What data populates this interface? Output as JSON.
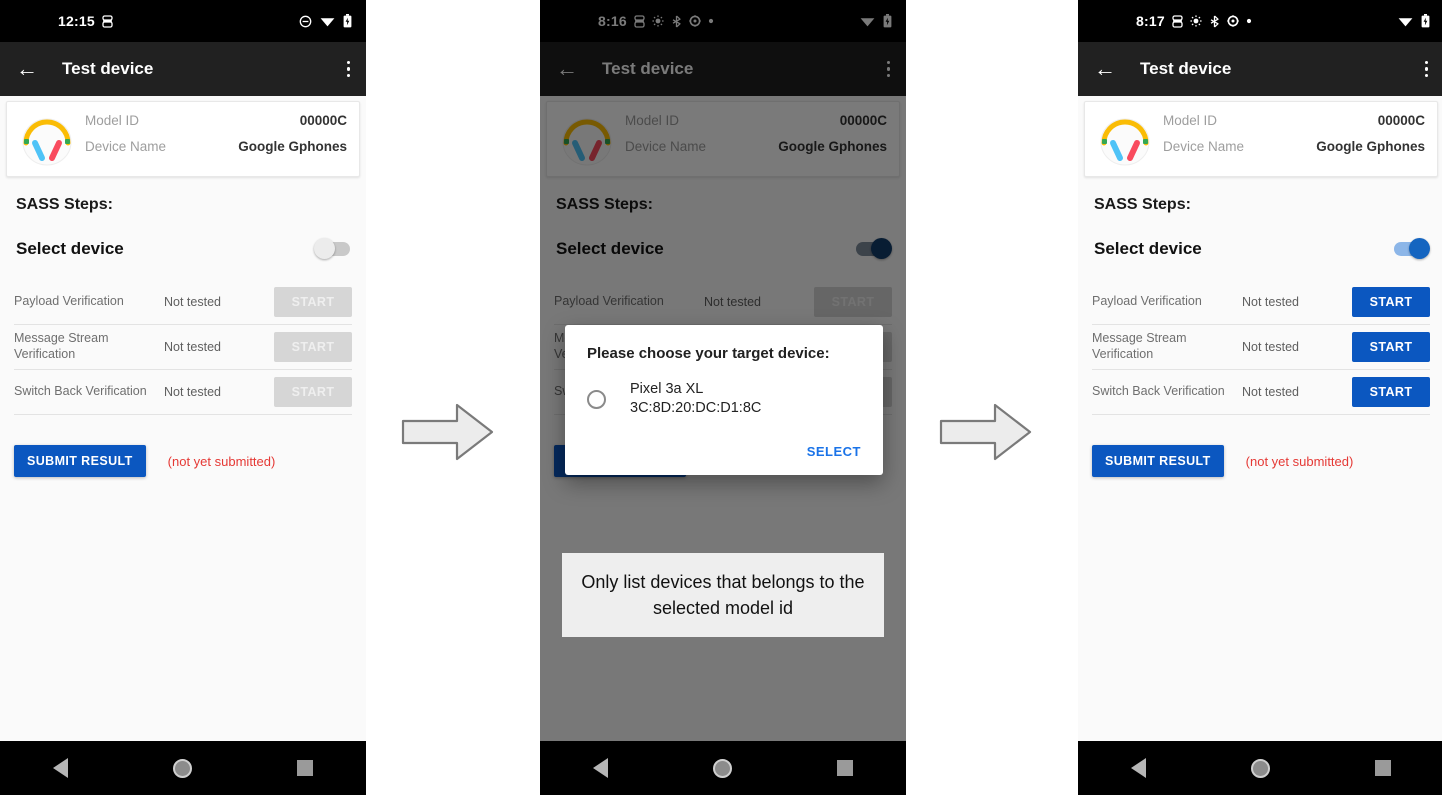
{
  "panels": [
    {
      "id": "panel-initial",
      "status_bar": {
        "time": "12:15",
        "left_icons": [
          "android-debug-icon"
        ],
        "right_icons": [
          "dnd-icon",
          "wifi-icon",
          "battery-icon"
        ]
      },
      "app_bar": {
        "back_icon": "back-arrow-icon",
        "title": "Test device",
        "overflow_icon": "overflow-menu-icon"
      },
      "device_card": {
        "icon": "headphones-icon",
        "rows": [
          {
            "label": "Model ID",
            "value": "00000C"
          },
          {
            "label": "Device Name",
            "value": "Google Gphones"
          }
        ]
      },
      "section_title": "SASS Steps:",
      "select_device": {
        "label": "Select device",
        "toggle_on": false
      },
      "tests": [
        {
          "name": "Payload Verification",
          "status": "Not tested",
          "button": "START",
          "enabled": false
        },
        {
          "name": "Message Stream Verification",
          "status": "Not tested",
          "button": "START",
          "enabled": false
        },
        {
          "name": "Switch Back Verification",
          "status": "Not tested",
          "button": "START",
          "enabled": false
        }
      ],
      "submit": {
        "label": "SUBMIT RESULT",
        "note": "(not yet submitted)"
      },
      "nav_bar": {
        "back": "nav-back-icon",
        "home": "nav-home-icon",
        "recents": "nav-recents-icon"
      },
      "dialog": null,
      "annotation": null,
      "dimmed": false
    },
    {
      "id": "panel-dialog",
      "status_bar": {
        "time": "8:16",
        "left_icons": [
          "android-debug-icon",
          "sync-icon",
          "bluetooth-scan-icon",
          "settings-icon",
          "dot-icon"
        ],
        "right_icons": [
          "wifi-icon",
          "battery-icon"
        ]
      },
      "app_bar": {
        "back_icon": "back-arrow-icon",
        "title": "Test device",
        "overflow_icon": "overflow-menu-icon"
      },
      "device_card": {
        "icon": "headphones-icon",
        "rows": [
          {
            "label": "Model ID",
            "value": "00000C"
          },
          {
            "label": "Device Name",
            "value": "Google Gphones"
          }
        ]
      },
      "section_title": "SASS Steps:",
      "select_device": {
        "label": "Select device",
        "toggle_on": true
      },
      "tests": [
        {
          "name": "Payload Verification",
          "status": "Not tested",
          "button": "START",
          "enabled": false
        },
        {
          "name": "Message Stream Verification",
          "status": "Not tested",
          "button": "START",
          "enabled": false
        },
        {
          "name": "Switch Back Verification",
          "status": "Not tested",
          "button": "START",
          "enabled": false
        }
      ],
      "submit": {
        "label": "SUBMIT RESULT",
        "note": "(not yet submitted)"
      },
      "nav_bar": {
        "back": "nav-back-icon",
        "home": "nav-home-icon",
        "recents": "nav-recents-icon"
      },
      "dialog": {
        "title": "Please choose your target device:",
        "options": [
          {
            "name": "Pixel 3a XL",
            "address": "3C:8D:20:DC:D1:8C",
            "selected": false
          }
        ],
        "action": "SELECT"
      },
      "annotation": "Only list devices that belongs to the selected model id",
      "dimmed": true
    },
    {
      "id": "panel-selected",
      "status_bar": {
        "time": "8:17",
        "left_icons": [
          "android-debug-icon",
          "sync-icon",
          "bluetooth-scan-icon",
          "settings-icon",
          "dot-icon"
        ],
        "right_icons": [
          "wifi-icon",
          "battery-icon"
        ]
      },
      "app_bar": {
        "back_icon": "back-arrow-icon",
        "title": "Test device",
        "overflow_icon": "overflow-menu-icon"
      },
      "device_card": {
        "icon": "headphones-icon",
        "rows": [
          {
            "label": "Model ID",
            "value": "00000C"
          },
          {
            "label": "Device Name",
            "value": "Google Gphones"
          }
        ]
      },
      "section_title": "SASS Steps:",
      "select_device": {
        "label": "Select device",
        "toggle_on": true
      },
      "tests": [
        {
          "name": "Payload Verification",
          "status": "Not tested",
          "button": "START",
          "enabled": true
        },
        {
          "name": "Message Stream Verification",
          "status": "Not tested",
          "button": "START",
          "enabled": true
        },
        {
          "name": "Switch Back Verification",
          "status": "Not tested",
          "button": "START",
          "enabled": true
        }
      ],
      "submit": {
        "label": "SUBMIT RESULT",
        "note": "(not yet submitted)"
      },
      "nav_bar": {
        "back": "nav-back-icon",
        "home": "nav-home-icon",
        "recents": "nav-recents-icon"
      },
      "dialog": null,
      "annotation": null,
      "dimmed": false
    }
  ],
  "flow_arrows": [
    {
      "name": "flow-arrow-1",
      "direction": "right"
    },
    {
      "name": "flow-arrow-2",
      "direction": "right"
    }
  ],
  "colors": {
    "accent_blue": "#0b57c0",
    "link_blue": "#1a73e8",
    "error_red": "#e53935",
    "appbar_dark": "#212121",
    "disabled_grey": "#d6d6d6"
  }
}
